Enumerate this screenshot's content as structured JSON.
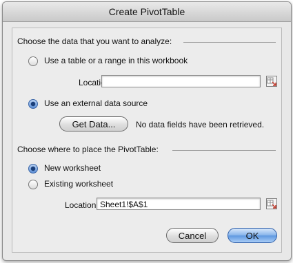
{
  "dialog": {
    "title": "Create PivotTable"
  },
  "data_section": {
    "heading": "Choose the data that you want to analyze:",
    "range_option_label": "Use a table or a range in this workbook",
    "location_label": "Location:",
    "location_value": "",
    "external_option_label": "Use an external data source",
    "get_data_label": "Get Data...",
    "status_text": "No data fields have been retrieved."
  },
  "place_section": {
    "heading": "Choose where to place the PivotTable:",
    "new_worksheet_label": "New worksheet",
    "existing_worksheet_label": "Existing worksheet",
    "location_label": "Location:",
    "location_value": "Sheet1!$A$1"
  },
  "buttons": {
    "cancel_label": "Cancel",
    "ok_label": "OK"
  },
  "selection": {
    "data_source": "external",
    "placement": "new_worksheet"
  },
  "colors": {
    "accent": "#5d97e0",
    "window_bg": "#e8e8e8"
  }
}
